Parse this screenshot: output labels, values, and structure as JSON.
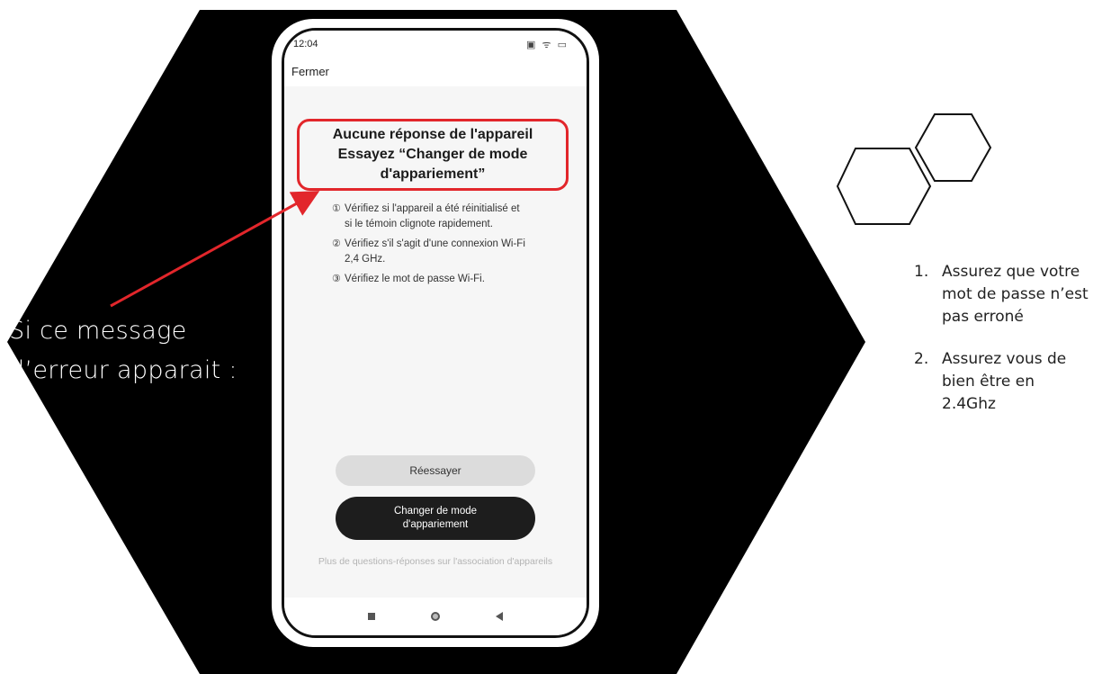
{
  "left_caption": {
    "line1": "Si ce message",
    "line2": "d’erreur apparait :"
  },
  "phone": {
    "status_bar": {
      "time": "12:04",
      "icons": "▣ ᯤ ▭"
    },
    "header": {
      "close_label": "Fermer"
    },
    "error": {
      "line1": "Aucune réponse de l'appareil",
      "line2": "Essayez “Changer de mode",
      "line3": "d'appariement”"
    },
    "tips": [
      {
        "num": "①",
        "text": "Vérifiez si l'appareil a été réinitialisé et si le témoin clignote rapidement."
      },
      {
        "num": "②",
        "text": "Vérifiez s'il s'agit d'une connexion Wi-Fi 2,4 GHz."
      },
      {
        "num": "③",
        "text": "Vérifiez le mot de passe Wi-Fi."
      }
    ],
    "retry_label": "Réessayer",
    "change_mode_line1": "Changer de mode",
    "change_mode_line2": "d'appariement",
    "faq_link": "Plus de questions-réponses sur l'association d'appareils"
  },
  "instructions": [
    {
      "num": "1.",
      "text": "Assurez que votre mot de passe n’est pas erroné"
    },
    {
      "num": "2.",
      "text": "Assurez vous de bien être en 2.4Ghz"
    }
  ],
  "colors": {
    "highlight": "#e2262b",
    "hexagon": "#000000",
    "dark_button": "#1d1d1d"
  }
}
